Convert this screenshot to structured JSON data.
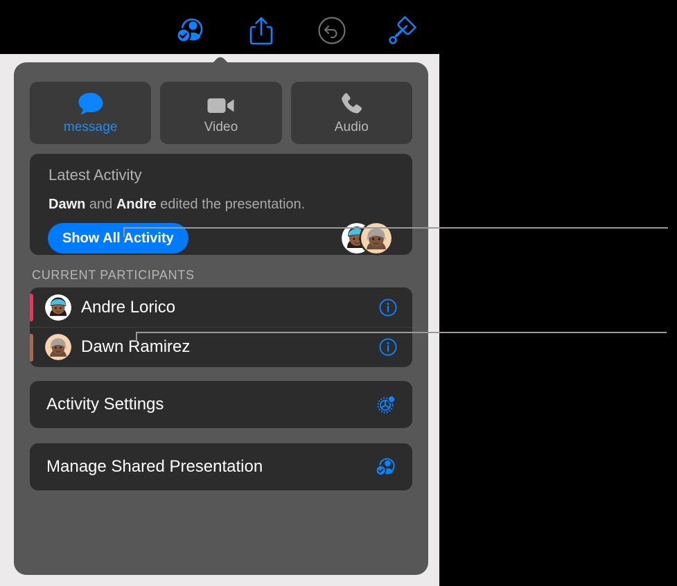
{
  "toolbar": {
    "buttons": [
      {
        "name": "collaboration",
        "icon": "person-checkmark-icon",
        "state": "active",
        "color": "#0a84ff"
      },
      {
        "name": "share",
        "icon": "share-icon",
        "state": "enabled",
        "color": "#0a84ff"
      },
      {
        "name": "undo",
        "icon": "undo-circle-icon",
        "state": "disabled",
        "color": "#6e6e6e"
      },
      {
        "name": "format",
        "icon": "paintbrush-icon",
        "state": "enabled",
        "color": "#0a84ff"
      }
    ]
  },
  "popover": {
    "comms": [
      {
        "label": "message",
        "icon": "message-bubble-icon",
        "accent": "#1f8cf5"
      },
      {
        "label": "Video",
        "icon": "video-camera-icon",
        "accent": "#b9b9b9"
      },
      {
        "label": "Audio",
        "icon": "phone-icon",
        "accent": "#b9b9b9"
      }
    ],
    "latest_activity": {
      "title": "Latest Activity",
      "summary_prefix": "",
      "summary_name_1": "Dawn",
      "summary_middle": " and ",
      "summary_name_2": "Andre",
      "summary_suffix": " edited the presentation.",
      "button_label": "Show All Activity",
      "button_color": "#007aff",
      "avatars": [
        {
          "name": "Andre Lorico avatar",
          "bg": "#ffffff"
        },
        {
          "name": "Dawn Ramirez avatar",
          "bg": "#f2d3ae"
        }
      ]
    },
    "participants_header": "CURRENT PARTICIPANTS",
    "participants": [
      {
        "name": "Andre Lorico",
        "color": "#ff2d55",
        "avatar_bg": "#ffffff",
        "info_icon": "info-circle-icon"
      },
      {
        "name": "Dawn Ramirez",
        "color": "#b4654a",
        "avatar_bg": "#f2d3ae",
        "info_icon": "info-circle-icon"
      }
    ],
    "actions": [
      {
        "label": "Activity Settings",
        "icon": "gear-person-icon"
      },
      {
        "label": "Manage Shared Presentation",
        "icon": "person-checkmark-icon"
      }
    ]
  },
  "callouts": [
    {
      "target": "show-all-activity-button"
    },
    {
      "target": "participant-row-andre-lorico"
    }
  ]
}
